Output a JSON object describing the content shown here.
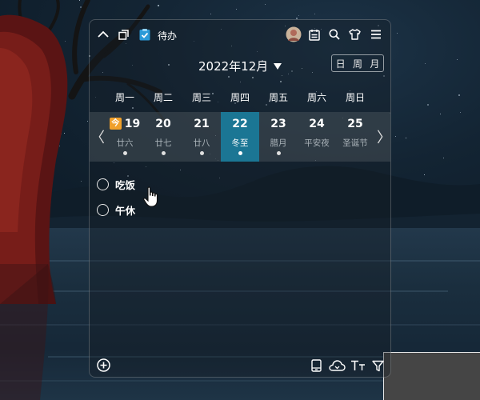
{
  "topbar": {
    "todo_label": "待办",
    "icons": [
      "chevron-up-icon",
      "window-icon",
      "todo-check-icon",
      "avatar",
      "calendar-icon",
      "search-icon",
      "skin-icon",
      "menu-icon"
    ]
  },
  "calendar": {
    "month_title": "2022年12月",
    "views": [
      {
        "label": "日",
        "active": true
      },
      {
        "label": "周",
        "active": false
      },
      {
        "label": "月",
        "active": false
      }
    ],
    "weekdays": [
      "周一",
      "周二",
      "周三",
      "周四",
      "周五",
      "周六",
      "周日"
    ],
    "prev_arrow": "〈",
    "next_arrow": "〉",
    "today_badge": "今",
    "days": [
      {
        "num": "19",
        "lunar": "廿六",
        "today": true,
        "selected": false,
        "has_event": true
      },
      {
        "num": "20",
        "lunar": "廿七",
        "today": false,
        "selected": false,
        "has_event": true
      },
      {
        "num": "21",
        "lunar": "廿八",
        "today": false,
        "selected": false,
        "has_event": true
      },
      {
        "num": "22",
        "lunar": "冬至",
        "today": false,
        "selected": true,
        "has_event": true
      },
      {
        "num": "23",
        "lunar": "腊月",
        "today": false,
        "selected": false,
        "has_event": true
      },
      {
        "num": "24",
        "lunar": "平安夜",
        "today": false,
        "selected": false,
        "has_event": false
      },
      {
        "num": "25",
        "lunar": "圣诞节",
        "today": false,
        "selected": false,
        "has_event": false
      }
    ]
  },
  "tasks": [
    {
      "label": "吃饭",
      "done": false
    },
    {
      "label": "午休",
      "done": false
    }
  ],
  "bottombar": {
    "icons": [
      "add-icon",
      "tablet-icon",
      "cloud-sync-icon",
      "text-size-icon",
      "filter-icon"
    ]
  },
  "colors": {
    "accent": "#1b7694",
    "today_badge": "#f0a02a",
    "corner_panel": "#454545"
  }
}
